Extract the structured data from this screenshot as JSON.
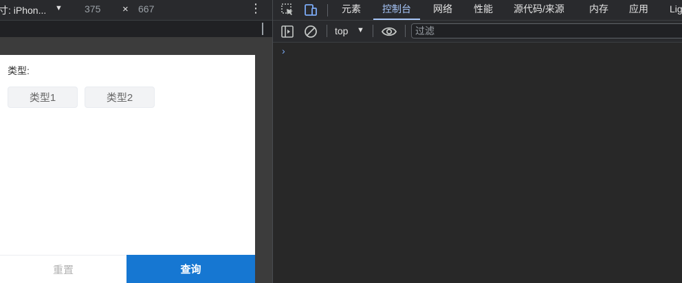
{
  "device_toolbar": {
    "device_label": "寸: iPhon...",
    "width": "375",
    "times": "×",
    "height": "667"
  },
  "page": {
    "type_label": "类型:",
    "chips": [
      "类型1",
      "类型2"
    ],
    "reset_label": "重置",
    "query_label": "查询"
  },
  "devtools": {
    "tabs": [
      "元素",
      "控制台",
      "网络",
      "性能",
      "源代码/来源",
      "内存",
      "应用",
      "Lig"
    ],
    "active_tab": "控制台",
    "context": "top",
    "filter_placeholder": "过滤",
    "prompt": "›"
  },
  "colors": {
    "accent": "#1677d2",
    "active_tab": "#a8c7fa",
    "devtools_bg": "#292a2d"
  },
  "icons": [
    "inspect-element-icon",
    "device-toggle-icon",
    "sidebar-icon",
    "clear-console-icon",
    "eye-icon",
    "more-vert-icon",
    "caret-down-icon"
  ]
}
